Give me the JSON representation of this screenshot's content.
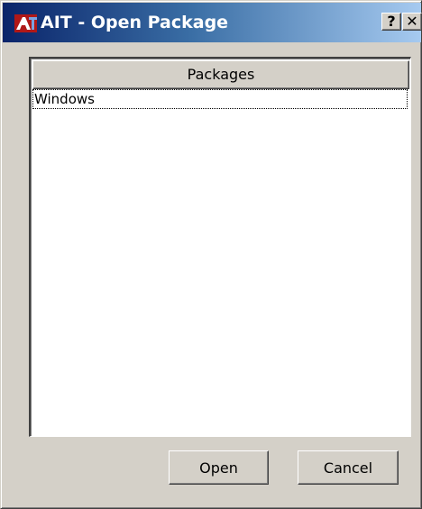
{
  "window": {
    "title": "AIT - Open Package",
    "help_label": "?",
    "close_label": "✕"
  },
  "packages_list": {
    "column_header": "Packages",
    "items": [
      {
        "label": "Windows"
      }
    ]
  },
  "buttons": {
    "open_label": "Open",
    "cancel_label": "Cancel"
  },
  "colors": {
    "titlebar_start": "#0a246a",
    "titlebar_end": "#a6caf0",
    "face": "#d4d0c8"
  },
  "icons": {
    "app": "ait-app-icon",
    "help": "help-icon",
    "close": "close-icon"
  }
}
